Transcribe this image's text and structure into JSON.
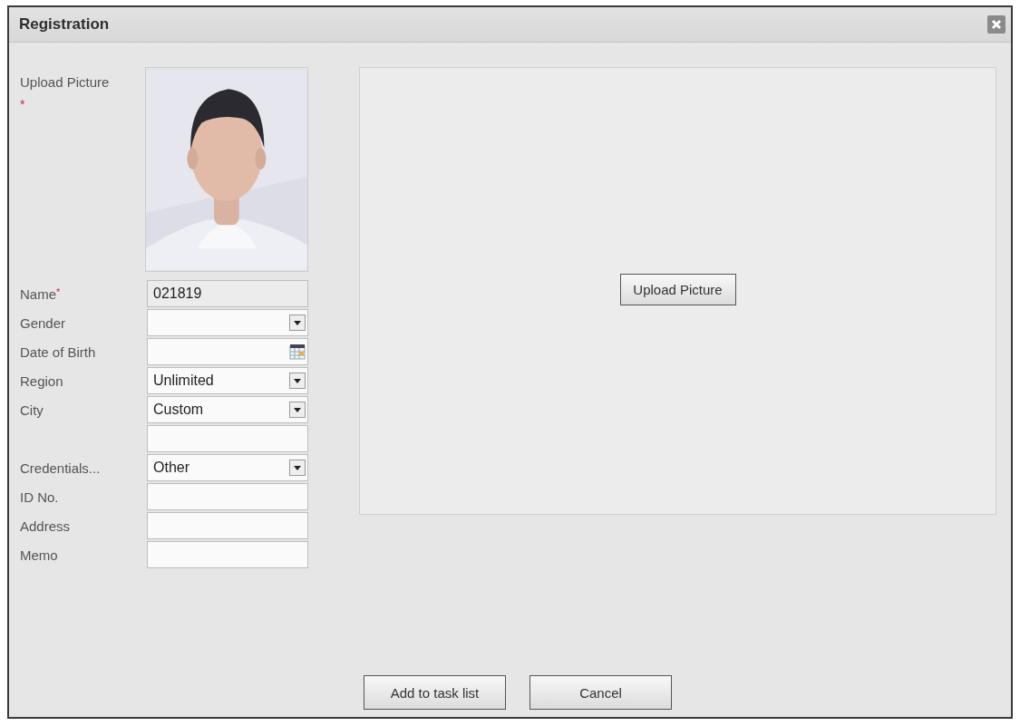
{
  "dialog": {
    "title": "Registration"
  },
  "photo": {
    "label": "Upload Picture",
    "required_mark": "*",
    "kind": "picture"
  },
  "fields": [
    {
      "kind": "text",
      "label": "Name",
      "required_mark": "*",
      "value": "021819"
    },
    {
      "kind": "select",
      "label": "Gender"
    },
    {
      "kind": "date",
      "label": "Date of Birth"
    },
    {
      "kind": "select",
      "label": "Region",
      "value": "Unlimited"
    },
    {
      "kind": "select",
      "label": "City",
      "value": "Custom"
    },
    {
      "kind": "input"
    },
    {
      "kind": "select",
      "label": "Credentials...",
      "value": "Other"
    },
    {
      "kind": "input",
      "label": "ID No."
    },
    {
      "kind": "input",
      "label": "Address"
    },
    {
      "kind": "input",
      "label": "Memo"
    }
  ],
  "preview": {
    "button": "Upload Picture"
  },
  "buttons": [
    "Add to task list",
    "Cancel"
  ]
}
